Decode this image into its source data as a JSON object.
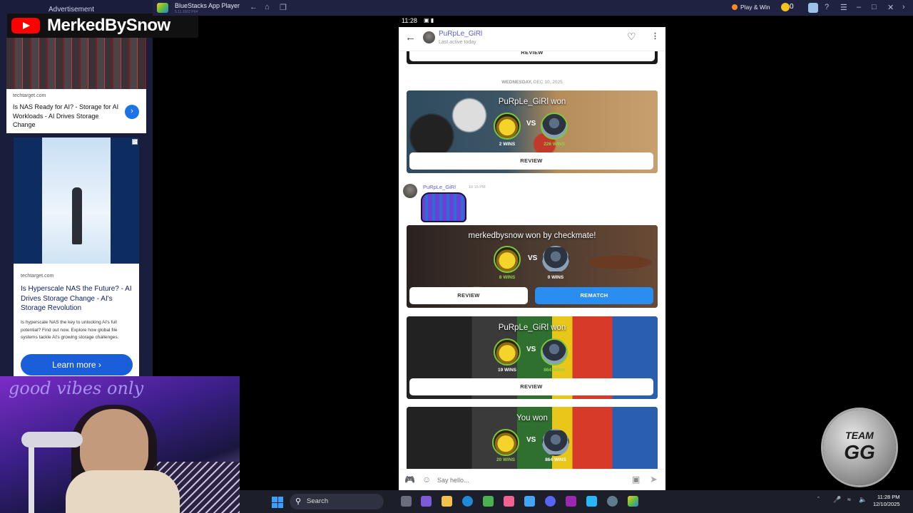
{
  "window": {
    "app_title": "BlueStacks App Player",
    "app_subtitle": "5.11.1002 P64",
    "play_win": "Play & Win",
    "coin_count": "0"
  },
  "overlay": {
    "channel_name": "MerkedBySnow",
    "team_logo_top": "TEAM",
    "team_logo_bottom": "GG",
    "neon_sign": "good vibes only"
  },
  "ads": {
    "label": "Advertisement",
    "ad1": {
      "domain": "techtarget.com",
      "headline": "Is NAS Ready for AI? - Storage for AI Workloads - AI Drives Storage Change"
    },
    "ad2": {
      "domain": "techtarget.com",
      "headline": "Is Hyperscale NAS the Future? - AI Drives Storage Change - AI's Storage Revolution",
      "description": "Is hyperscale NAS the key to unlocking AI's full potential? Find out now. Explore how global file systems tackle AI's growing storage challenges.",
      "cta": "Learn more"
    }
  },
  "phone": {
    "time": "11:28",
    "contact": {
      "name": "PuRpLe_GiRl",
      "status": "Last active today"
    },
    "date_separator": {
      "day": "WEDNESDAY,",
      "date": "DEC 10, 2025"
    },
    "top_card_button": "REVIEW",
    "games": [
      {
        "result": "PuRpLe_GiRl won",
        "left_wins": "2 WINS",
        "right_wins": "226 WINS",
        "vs": "VS",
        "button": "REVIEW"
      },
      {
        "result": "merkedbysnow won by checkmate!",
        "left_wins": "8 WINS",
        "right_wins": "0 WINS",
        "vs": "VS",
        "button": "REVIEW",
        "button2": "REMATCH"
      },
      {
        "result": "PuRpLe_GiRl won",
        "left_wins": "19 WINS",
        "right_wins": "864 WINS",
        "vs": "VS",
        "button": "REVIEW"
      },
      {
        "result": "You won",
        "left_wins": "20 WINS",
        "right_wins": "864 WINS",
        "vs": "VS"
      }
    ],
    "message": {
      "sender": "PuRpLe_GiRl",
      "time": "10:15 PM"
    },
    "composer": {
      "placeholder": "Say hello..."
    }
  },
  "taskbar": {
    "search_label": "Search",
    "clock_time": "11:28 PM",
    "clock_date": "12/10/2025"
  },
  "colors": {
    "accent_purple": "#5c5bd1",
    "rematch_blue": "#2a8df0",
    "win_green": "#7bc83b"
  }
}
